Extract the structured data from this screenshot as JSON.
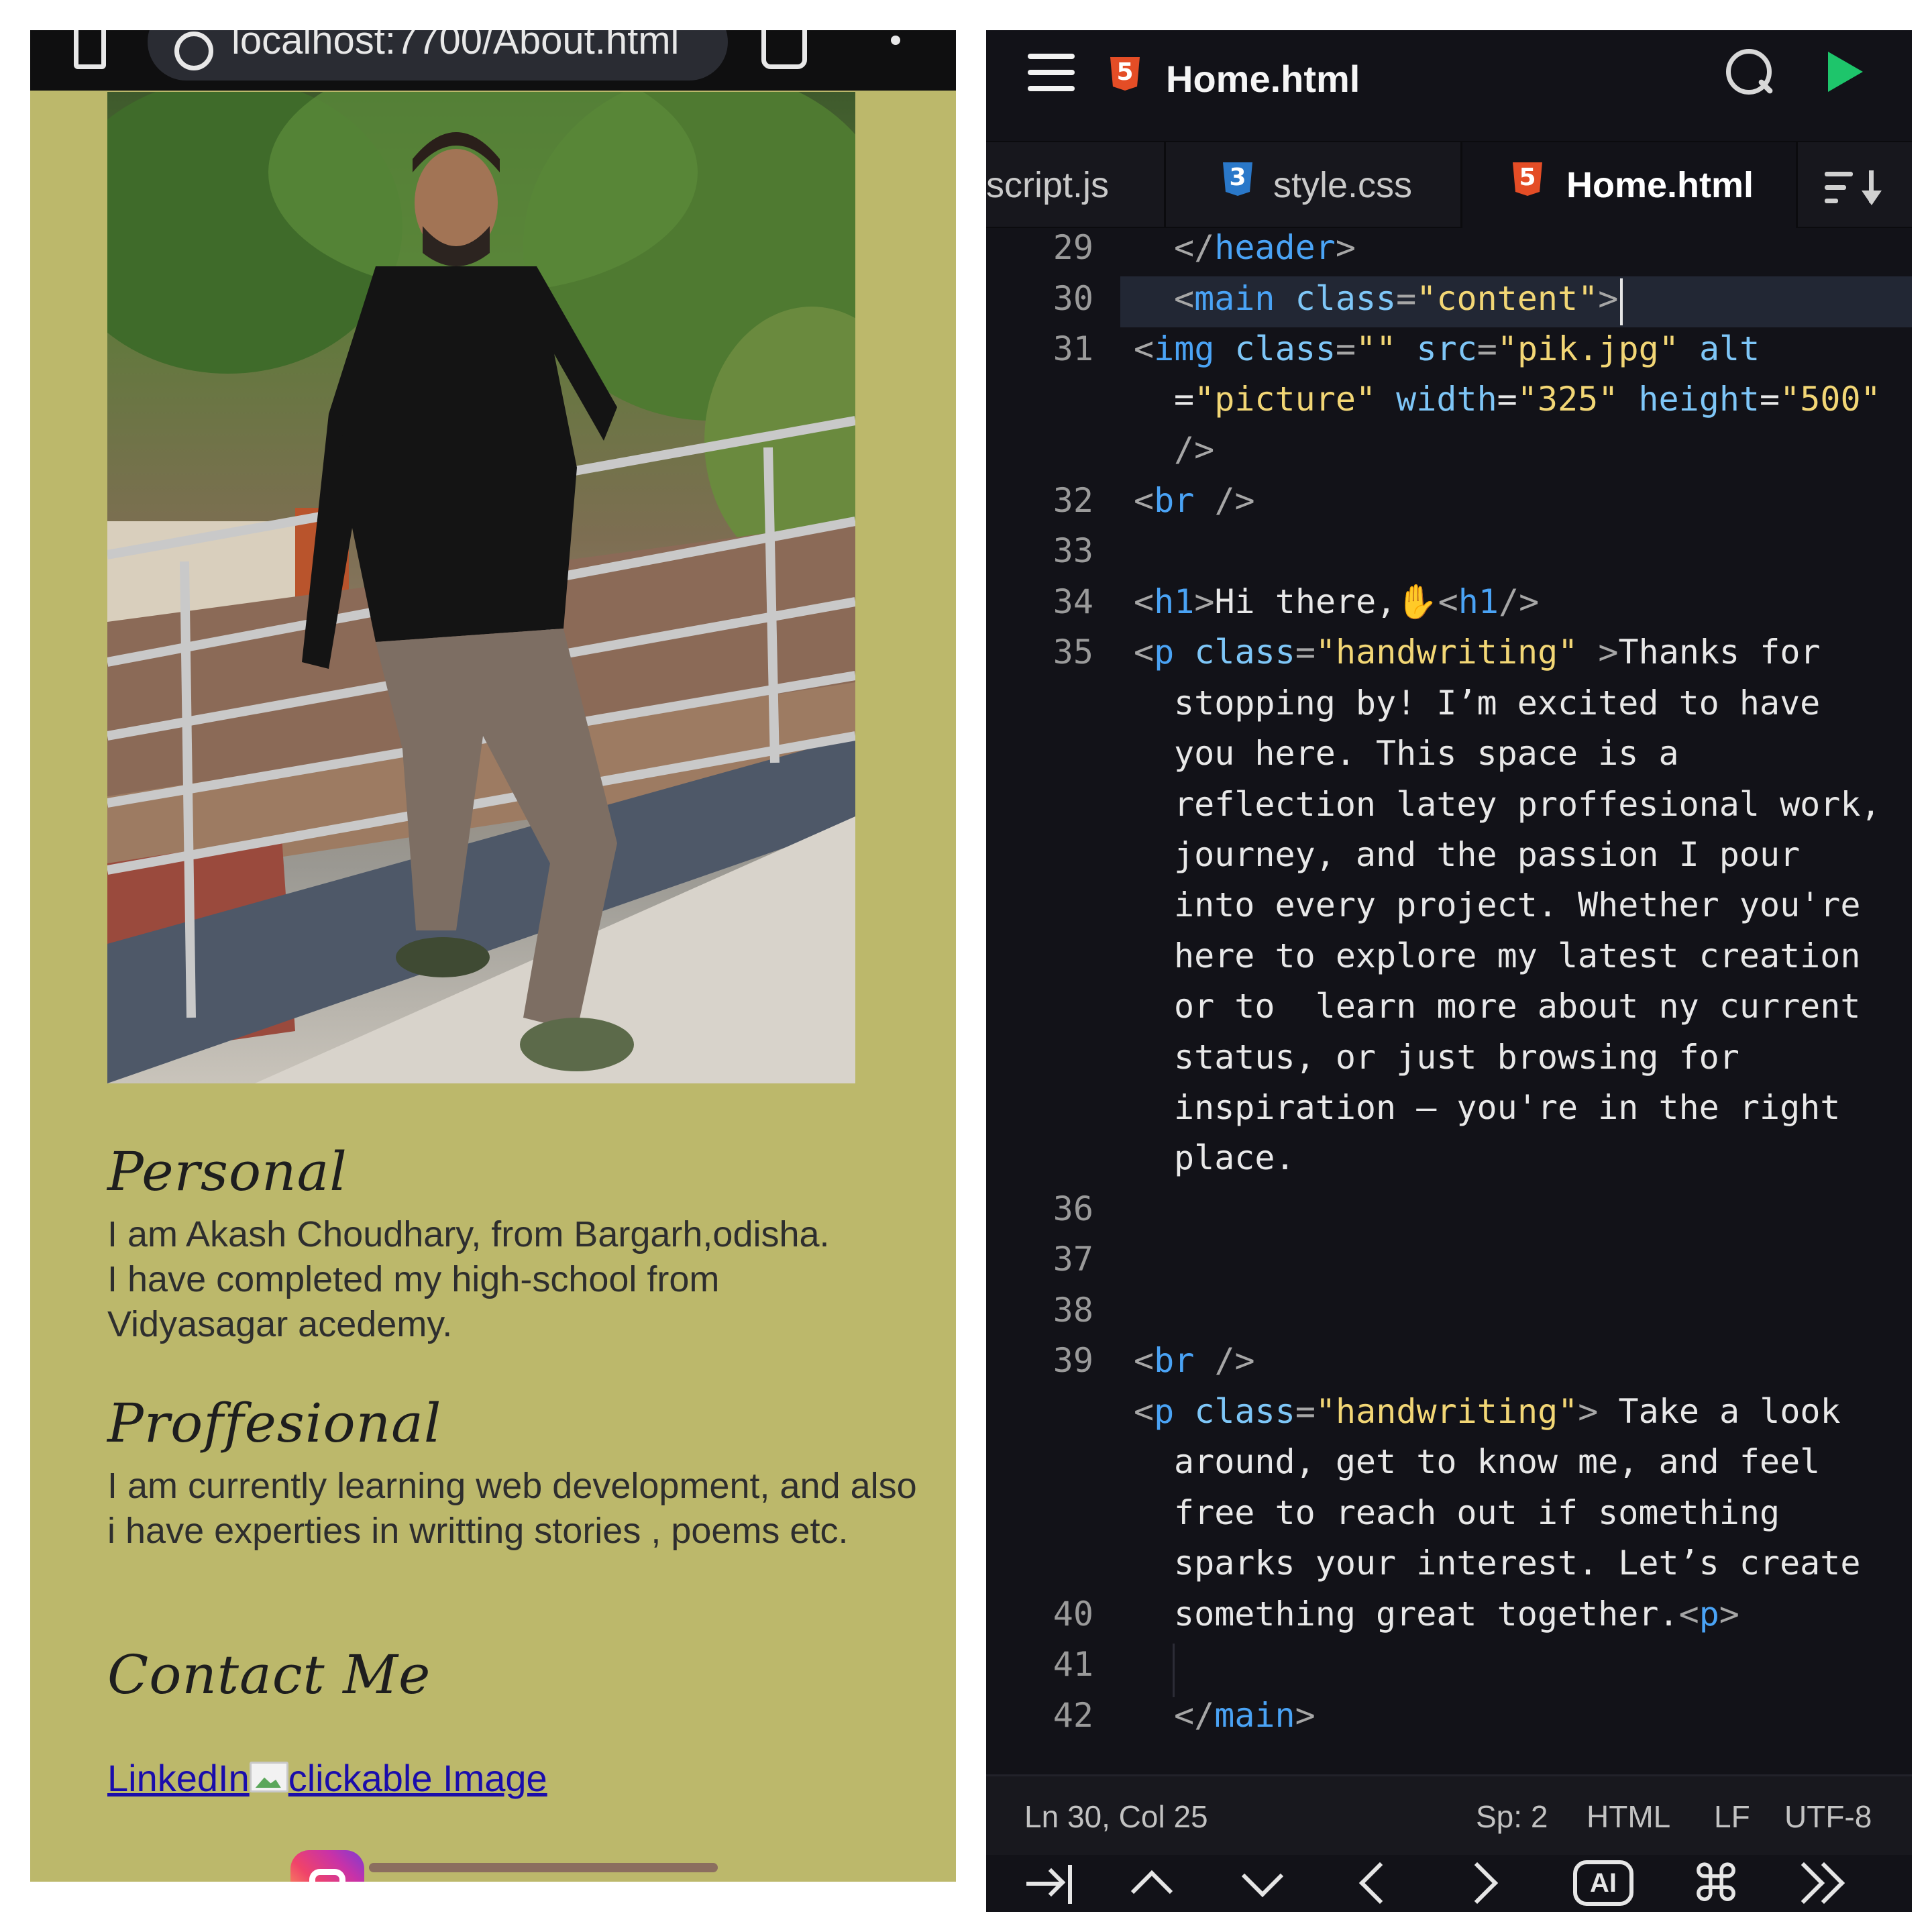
{
  "browser": {
    "url": "localhost:7700/About.html"
  },
  "preview": {
    "photo_alt": "picture",
    "sections": [
      {
        "heading": "Personal",
        "body": "I am Akash Choudhary, from Bargarh,odisha.\nI have completed my high-school from Vidyasagar acedemy."
      },
      {
        "heading": "Proffesional",
        "body": "I am currently learning web development, and also i have experties in writting stories , poems etc."
      },
      {
        "heading": "Contact Me",
        "body": ""
      }
    ],
    "links": {
      "linkedin": "LinkedIn",
      "clickable": "clickable Image"
    }
  },
  "editor": {
    "title": "Home.html",
    "tabs": [
      {
        "label": "script.js",
        "icon": "js-file-icon",
        "active": false
      },
      {
        "label": "style.css",
        "icon": "css3-icon",
        "active": false
      },
      {
        "label": "Home.html",
        "icon": "html5-icon",
        "active": true
      }
    ],
    "gutter": [
      "29",
      "30",
      "31",
      "32",
      "33",
      "34",
      "35",
      "36",
      "37",
      "38",
      "39",
      "40",
      "41",
      "42"
    ],
    "code_lines": {
      "l29": "</header>",
      "l30": "<main class=\"content\">",
      "l31a": "<img class=\"\" src=\"pik.jpg\" alt",
      "l31b": "=\"picture\" width=\"325\" height=\"500\"",
      "l31c": "/>",
      "l32": "<br />",
      "l34": "<h1>Hi there,✋<h1/>",
      "l35": [
        "<p class=\"handwriting\" >Thanks for",
        "stopping by! I’m excited to have",
        "you here. This space is a",
        "reflection latey proffesional work,",
        "journey, and the passion I pour",
        "into every project. Whether you're",
        "here to explore my latest creation",
        "or to  learn more about ny current",
        "status, or just browsing for",
        "inspiration — you're in the right",
        "place."
      ],
      "l38": "<br />",
      "l39": [
        "<p class=\"handwriting\"> Take a look",
        "around, get to know me, and feel",
        "free to reach out if something",
        "sparks your interest. Let’s create",
        "something great together.<p>"
      ],
      "l42": "</main>"
    },
    "status": {
      "cursor": "Ln 30, Col 25",
      "spaces": "Sp: 2",
      "language": "HTML",
      "line_ending": "LF",
      "encoding": "UTF-8"
    },
    "keys": [
      "tab-key",
      "arrow-up",
      "arrow-down",
      "arrow-left",
      "arrow-right",
      "ai",
      "command",
      "more"
    ],
    "ai_label": "AI",
    "cmd_glyph": "⌘"
  },
  "colors": {
    "preview_bg": "#bcb86b",
    "editor_bg": "#121218",
    "tag": "#4aa3f5",
    "attr": "#7ec6f7",
    "string": "#f2d675",
    "run": "#1ec56b",
    "html5": "#e44d26",
    "css3": "#2a78c9"
  }
}
